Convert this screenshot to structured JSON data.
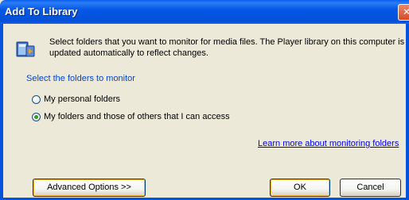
{
  "window": {
    "title": "Add To Library",
    "close_glyph": "✕"
  },
  "info": {
    "line1": "Select folders that you want to monitor for media files. The Player library on this computer is",
    "line2": "updated automatically to reflect changes.",
    "icon": "media-player-library-icon"
  },
  "section": {
    "label": "Select the folders to monitor"
  },
  "options": [
    {
      "label": "My personal folders",
      "checked": false
    },
    {
      "label": "My folders and those of others that I can access",
      "checked": true
    }
  ],
  "link": {
    "label": "Learn more about monitoring folders"
  },
  "buttons": {
    "advanced": "Advanced Options >>",
    "ok": "OK",
    "cancel": "Cancel"
  },
  "colors": {
    "titlebar": "#0453dc",
    "section_label": "#0046d5",
    "link": "#0000ee",
    "dialog_bg": "#ece9d8"
  }
}
